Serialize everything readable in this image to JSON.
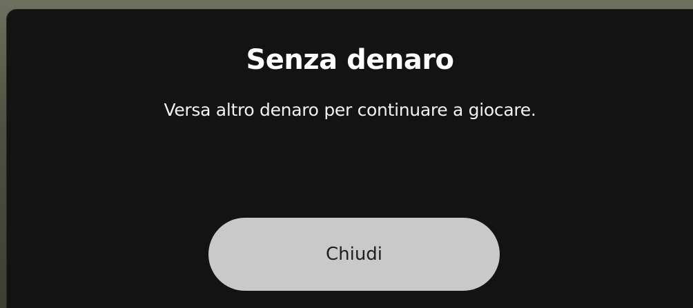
{
  "dialog": {
    "title": "Senza denaro",
    "message": "Versa altro denaro per continuare a giocare.",
    "close_label": "Chiudi"
  },
  "colors": {
    "dialog_background": "#131313",
    "button_background": "#c9c9c9",
    "title_text": "#ffffff"
  }
}
